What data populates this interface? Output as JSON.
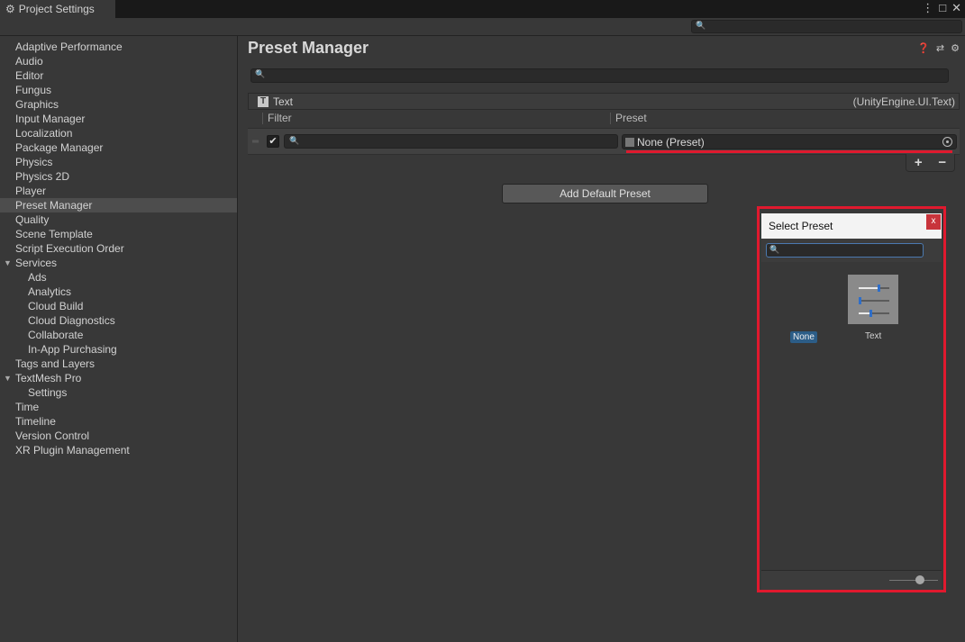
{
  "window": {
    "tab_title": "Project Settings",
    "controls": [
      "⋮",
      "□",
      "✕"
    ]
  },
  "sidebar": {
    "items": [
      {
        "label": "Adaptive Performance"
      },
      {
        "label": "Audio"
      },
      {
        "label": "Editor"
      },
      {
        "label": "Fungus"
      },
      {
        "label": "Graphics"
      },
      {
        "label": "Input Manager"
      },
      {
        "label": "Localization"
      },
      {
        "label": "Package Manager"
      },
      {
        "label": "Physics"
      },
      {
        "label": "Physics 2D"
      },
      {
        "label": "Player"
      },
      {
        "label": "Preset Manager"
      },
      {
        "label": "Quality"
      },
      {
        "label": "Scene Template"
      },
      {
        "label": "Script Execution Order"
      },
      {
        "label": "Services"
      },
      {
        "label": "Ads"
      },
      {
        "label": "Analytics"
      },
      {
        "label": "Cloud Build"
      },
      {
        "label": "Cloud Diagnostics"
      },
      {
        "label": "Collaborate"
      },
      {
        "label": "In-App Purchasing"
      },
      {
        "label": "Tags and Layers"
      },
      {
        "label": "TextMesh Pro"
      },
      {
        "label": "Settings"
      },
      {
        "label": "Time"
      },
      {
        "label": "Timeline"
      },
      {
        "label": "Version Control"
      },
      {
        "label": "XR Plugin Management"
      }
    ],
    "selected": "Preset Manager"
  },
  "main": {
    "title": "Preset Manager",
    "title_icons": [
      "help-icon",
      "sliders-icon",
      "gear-icon"
    ],
    "preset_type": {
      "name": "Text",
      "full_type": "(UnityEngine.UI.Text)"
    },
    "columns": {
      "filter": "Filter",
      "preset": "Preset"
    },
    "row": {
      "enabled": true,
      "filter_value": "",
      "preset_value": "None (Preset)"
    },
    "plus_label": "+",
    "minus_label": "−",
    "add_default_label": "Add Default Preset"
  },
  "select_preset": {
    "title": "Select Preset",
    "close_label": "x",
    "search_value": "",
    "items": [
      {
        "label": "None",
        "selected": true
      },
      {
        "label": "Text",
        "selected": false
      }
    ]
  },
  "colors": {
    "highlight_red": "#e0192e",
    "selection_blue": "#2c5d87"
  }
}
